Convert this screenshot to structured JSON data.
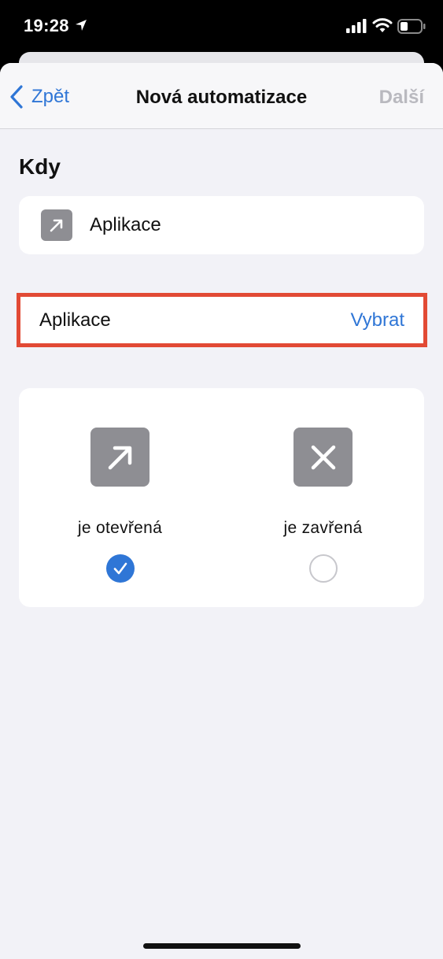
{
  "status_bar": {
    "time": "19:28",
    "icons": [
      "location-arrow-icon",
      "cellular-signal-icon",
      "wifi-icon",
      "battery-icon"
    ]
  },
  "nav": {
    "back_label": "Zpět",
    "title": "Nová automatizace",
    "next_label": "Další"
  },
  "section": {
    "title": "Kdy"
  },
  "trigger": {
    "label": "Aplikace",
    "icon": "arrow-up-right-icon"
  },
  "app_select": {
    "label": "Aplikace",
    "action": "Vybrat"
  },
  "options": [
    {
      "label": "je otevřená",
      "icon": "arrow-up-right-icon",
      "selected": true
    },
    {
      "label": "je zavřená",
      "icon": "x-mark-icon",
      "selected": false
    }
  ],
  "colors": {
    "accent": "#2f76d6",
    "highlight_border": "#e24a35",
    "icon_tile": "#8e8e93",
    "background": "#f2f2f7"
  }
}
